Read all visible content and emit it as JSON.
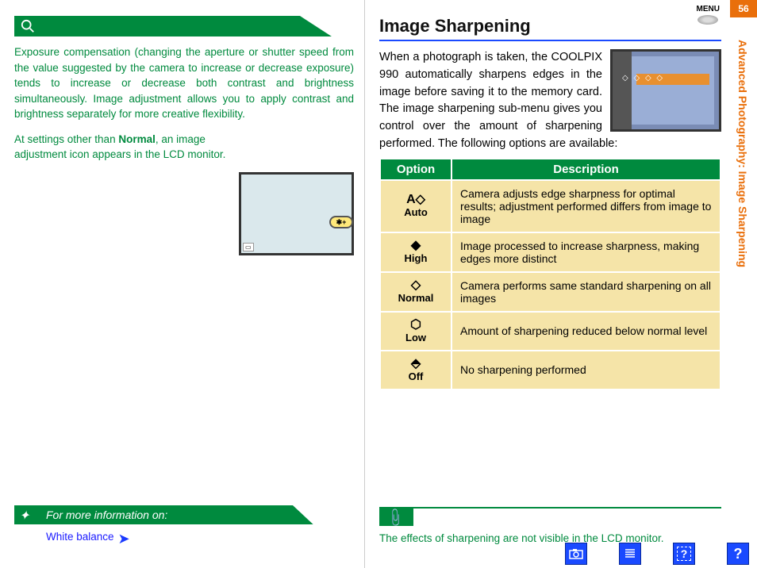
{
  "pageNumber": "56",
  "sideLabel": "Advanced Photography: Image Sharpening",
  "menuLabel": "MENU",
  "left": {
    "para1": "Exposure compensation (changing the aperture or shutter speed from the value suggested by the camera to increase or decrease exposure) tends to increase or decrease both contrast and brightness simultaneously.  Image adjustment allows you to apply contrast and brightness separately for more creative flexibility.",
    "para2a": "At settings other than ",
    "para2b": "Normal",
    "para2c": ", an image adjustment icon appears in the LCD monitor.",
    "lcdBadge": "✱+",
    "moreInfoTitle": "For more information on:",
    "linkLabel": "White balance"
  },
  "right": {
    "title": "Image Sharpening",
    "intro": "When a photograph is taken, the COOLPIX 990 automatically sharpens edges in the image before saving it to the memory card. The image sharpening sub-menu gives you control over the amount of sharpening performed.  The following options are available:",
    "headers": {
      "option": "Option",
      "description": "Description"
    },
    "rows": [
      {
        "icon": "A◇",
        "label": "Auto",
        "desc": "Camera adjusts edge sharpness for optimal results; adjustment performed differs from image to image"
      },
      {
        "icon": "◆",
        "label": "High",
        "desc": "Image processed to increase sharpness, making edges more distinct"
      },
      {
        "icon": "◇",
        "label": "Normal",
        "desc": "Camera performs same standard sharpening on all images"
      },
      {
        "icon": "⬡",
        "label": "Low",
        "desc": "Amount of sharpening reduced below normal level"
      },
      {
        "icon": "⬘",
        "label": "Off",
        "desc": "No sharpening performed"
      }
    ],
    "note": "The effects of sharpening are not visible in the LCD monitor."
  }
}
